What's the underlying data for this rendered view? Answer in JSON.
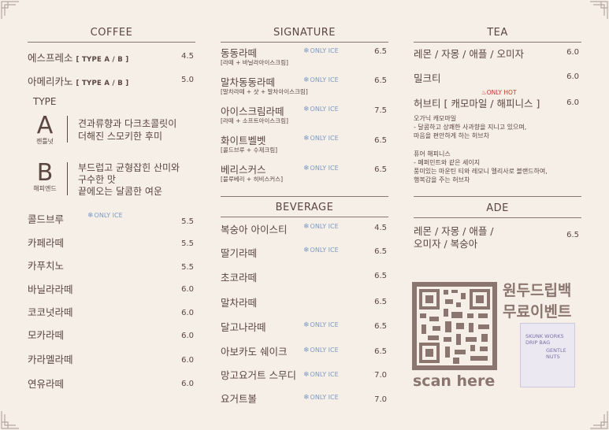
{
  "coffee": {
    "title": "COFFEE",
    "espresso": {
      "name": "에스프레소",
      "tag": "[ TYPE A / B ]",
      "price": "4.5"
    },
    "americano": {
      "name": "아메리카노",
      "tag": "[ TYPE A / B ]",
      "price": "5.0"
    },
    "type_label": "TYPE",
    "type_a": {
      "letter": "A",
      "name": "젠틀넛",
      "desc1": "견과류향과 다크초콜릿이",
      "desc2": "더해진 스모키한 후미"
    },
    "type_b": {
      "letter": "B",
      "name": "해피엔드",
      "desc1": "부드럽고 균형잡힌 산미와",
      "desc2": "구수한 맛",
      "desc3": "끝에오는 달콤한 여운"
    },
    "items": [
      {
        "name": "콜드브루",
        "price": "5.5",
        "ice": "ONLY ICE"
      },
      {
        "name": "카페라떼",
        "price": "5.5"
      },
      {
        "name": "카푸치노",
        "price": "5.5"
      },
      {
        "name": "바닐라라떼",
        "price": "6.0"
      },
      {
        "name": "코코넛라떼",
        "price": "6.0"
      },
      {
        "name": "모카라떼",
        "price": "6.0"
      },
      {
        "name": "카라멜라떼",
        "price": "6.0"
      },
      {
        "name": "연유라떼",
        "price": "6.0"
      }
    ]
  },
  "signature": {
    "title": "SIGNATURE",
    "items": [
      {
        "name": "동동라떼",
        "sub": "[라떼 + 바닐라아이스크림]",
        "ice": "ONLY ICE",
        "price": "6.5"
      },
      {
        "name": "말차동동라떼",
        "sub": "[말차라떼 + 샷 + 말차아이스크림]",
        "ice": "ONLY ICE",
        "price": "6.5"
      },
      {
        "name": "아이스크림라떼",
        "sub": "[라떼 + 소프트아이스크림]",
        "ice": "ONLY ICE",
        "price": "7.5"
      },
      {
        "name": "화이트벨벳",
        "sub": "[콜드브루 + 수제크림]",
        "ice": "ONLY ICE",
        "price": "6.5"
      },
      {
        "name": "베리스커스",
        "sub": "[블루베리 + 히비스커스]",
        "ice": "ONLY ICE",
        "price": "6.5"
      }
    ]
  },
  "beverage": {
    "title": "BEVERAGE",
    "items": [
      {
        "name": "복숭아 아이스티",
        "ice": "ONLY ICE",
        "price": "4.5"
      },
      {
        "name": "딸기라떼",
        "ice": "ONLY ICE",
        "price": "6.5"
      },
      {
        "name": "초코라떼",
        "price": "6.5"
      },
      {
        "name": "말차라떼",
        "price": "6.5"
      },
      {
        "name": "달고나라떼",
        "ice": "ONLY ICE",
        "price": "6.5"
      },
      {
        "name": "아보카도 쉐이크",
        "ice": "ONLY ICE",
        "price": "6.5"
      },
      {
        "name": "망고요거트 스무디",
        "ice": "ONLY ICE",
        "price": "7.0"
      },
      {
        "name": "요거트볼",
        "ice": "ONLY ICE",
        "price": "7.0"
      }
    ]
  },
  "tea": {
    "title": "TEA",
    "items": [
      {
        "name": "레몬 / 자몽 / 애플 / 오미자",
        "price": "6.0"
      },
      {
        "name": "밀크티",
        "price": "6.0"
      },
      {
        "name": "허브티   [ 캐모마일 / 해피니스 ]",
        "price": "6.0",
        "hot": "ONLY HOT"
      }
    ],
    "notes": [
      "오가닉 캐모마일",
      "- 달콤하고 상쾌한 사과향을 지니고 있으며,",
      "   마음을 편안하게 하는 허브차",
      "",
      "퓨어 해피니스",
      "- 페퍼민트와 같은 세이지",
      "   풍미있는 마운틴 티와 레모니 멜리사로 블랜드하여,",
      "   행복감을 주는 허브차"
    ]
  },
  "ade": {
    "title": "ADE",
    "line1": "레몬 / 자몽 /  애플 /",
    "line2": "오미자 / 복숭아",
    "price": "6.5"
  },
  "promo": {
    "event_line1": "원두드립백",
    "event_line2": "무료이벤트",
    "scan": "scan here",
    "bag_text": [
      "SKUNK WORKS",
      "DRIP   BAG",
      "GENTLE",
      "NUTS"
    ]
  }
}
